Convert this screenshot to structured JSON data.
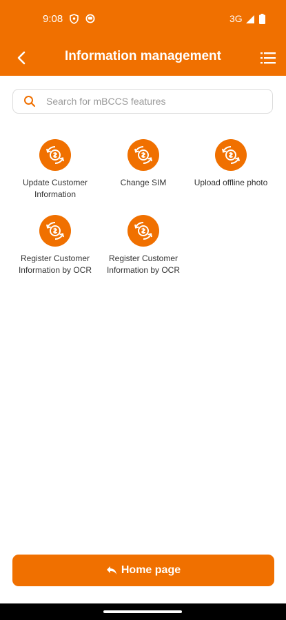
{
  "status_bar": {
    "time": "9:08",
    "network": "3G",
    "icons": [
      "location-shield-icon",
      "ring-icon",
      "signal-icon",
      "battery-icon"
    ]
  },
  "app_bar": {
    "title": "Information management",
    "back_icon": "chevron-left-icon",
    "menu_icon": "list-menu-icon"
  },
  "search": {
    "placeholder": "Search for mBCCS features",
    "value": "",
    "icon": "search-icon"
  },
  "features": [
    {
      "label": "Update Customer Information",
      "icon": "money-swap-icon"
    },
    {
      "label": "Change SIM",
      "icon": "money-swap-icon"
    },
    {
      "label": "Upload offline photo",
      "icon": "money-swap-icon"
    },
    {
      "label": "Register Customer Information by OCR",
      "icon": "money-swap-icon"
    },
    {
      "label": "Register Customer Information by OCR",
      "icon": "money-swap-icon"
    }
  ],
  "home_button": {
    "label": "Home page",
    "icon": "reply-arrow-icon"
  },
  "colors": {
    "primary": "#f07000",
    "background": "#ffffff",
    "text": "#333333",
    "placeholder": "#9a9a9a"
  }
}
